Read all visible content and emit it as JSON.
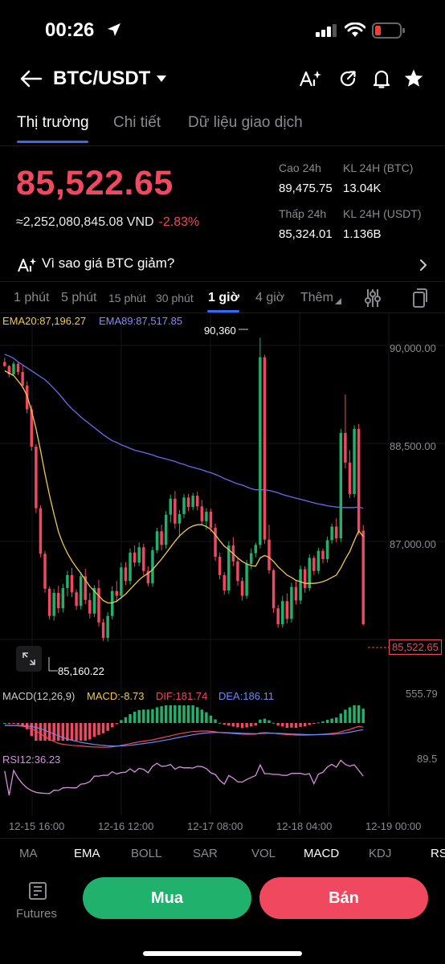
{
  "status": {
    "time": "00:26"
  },
  "header": {
    "pair": "BTC/USDT"
  },
  "tabs": [
    {
      "label": "Thị trường"
    },
    {
      "label": "Chi tiết"
    },
    {
      "label": "Dữ liệu giao dịch"
    }
  ],
  "ticker": {
    "price": "85,522.65",
    "vnd": "≈2,252,080,845.08 VND",
    "change": "-2.83%",
    "high_label": "Cao 24h",
    "high_value": "89,475.75",
    "vol_btc_label": "KL 24H (BTC)",
    "vol_btc_value": "13.04K",
    "low_label": "Thấp 24h",
    "low_value": "85,324.01",
    "vol_usdt_label": "KL 24H  (USDT)",
    "vol_usdt_value": "1.136B"
  },
  "why": {
    "text": "Vì sao giá BTC giảm?"
  },
  "intervals": [
    {
      "label": "1 phút"
    },
    {
      "label": "5 phút"
    },
    {
      "label": "15 phút"
    },
    {
      "label": "30 phút"
    },
    {
      "label": "1 giờ"
    },
    {
      "label": "4 giờ"
    },
    {
      "label": "Thêm"
    }
  ],
  "chart_labels": {
    "ema20": "EMA20:87,196.27",
    "ema89": "EMA89:87,517.85",
    "high_marker": "90,360",
    "low_marker": "85,160.22",
    "last_price": "85,522.65",
    "y_ticks": [
      "90,000.00",
      "88,500.00",
      "87,000.00"
    ],
    "macd_title": "MACD(12,26,9)",
    "macd_val": "MACD:-8.73",
    "dif_val": "DIF:181.74",
    "dea_val": "DEA:186.11",
    "macd_axis": "555.79",
    "rsi_title": "RSI12:36.23",
    "rsi_axis": "89.5",
    "x_ticks": [
      "12-15 16:00",
      "12-16 12:00",
      "12-17 08:00",
      "12-18 04:00",
      "12-19 00:00"
    ]
  },
  "indicator_tabs": [
    {
      "label": "MA"
    },
    {
      "label": "EMA"
    },
    {
      "label": "BOLL"
    },
    {
      "label": "SAR"
    },
    {
      "label": "VOL"
    },
    {
      "label": "MACD"
    },
    {
      "label": "KDJ"
    },
    {
      "label": "RS"
    }
  ],
  "bottom": {
    "futures": "Futures",
    "buy": "Mua",
    "sell": "Bán"
  },
  "colors": {
    "up": "#20b26c",
    "down": "#f0485e",
    "accent": "#2f6df6",
    "ema20": "#f2c94c",
    "ema89": "#6b6bf0",
    "rsi": "#d88ee0"
  },
  "chart_data": {
    "type": "candlestick",
    "ylim": [
      85100,
      90500
    ],
    "candles": [
      [
        89950,
        90020,
        89870,
        89880
      ],
      [
        89880,
        89900,
        89690,
        89740
      ],
      [
        89740,
        89960,
        89730,
        89920
      ],
      [
        89920,
        89950,
        89730,
        89780
      ],
      [
        89780,
        89900,
        89500,
        89550
      ],
      [
        89550,
        89620,
        89080,
        89150
      ],
      [
        89150,
        89220,
        88450,
        88520
      ],
      [
        88520,
        88560,
        87400,
        87480
      ],
      [
        87480,
        87530,
        86650,
        86710
      ],
      [
        86710,
        86760,
        86050,
        86120
      ],
      [
        86120,
        86160,
        85600,
        85660
      ],
      [
        85660,
        86120,
        85580,
        86050
      ],
      [
        86050,
        86170,
        85710,
        85790
      ],
      [
        85790,
        86200,
        85720,
        86130
      ],
      [
        86130,
        86420,
        85990,
        86350
      ],
      [
        86350,
        86470,
        85980,
        86060
      ],
      [
        86060,
        86110,
        85760,
        85830
      ],
      [
        85830,
        86400,
        85770,
        86330
      ],
      [
        86330,
        86460,
        85860,
        85930
      ],
      [
        85930,
        86050,
        85620,
        85700
      ],
      [
        85700,
        86180,
        85640,
        86130
      ],
      [
        86130,
        86270,
        85480,
        85550
      ],
      [
        85550,
        85610,
        85240,
        85290
      ],
      [
        85290,
        85720,
        85230,
        85660
      ],
      [
        85660,
        86160,
        85600,
        86080
      ],
      [
        86080,
        86250,
        85890,
        86000
      ],
      [
        86000,
        86560,
        85940,
        86480
      ],
      [
        86480,
        86570,
        86180,
        86250
      ],
      [
        86250,
        86800,
        86190,
        86730
      ],
      [
        86730,
        86850,
        86490,
        86560
      ],
      [
        86560,
        86900,
        86500,
        86820
      ],
      [
        86820,
        86880,
        86350,
        86420
      ],
      [
        86420,
        86500,
        86160,
        86210
      ],
      [
        86210,
        86830,
        86150,
        86770
      ],
      [
        86770,
        87150,
        86720,
        87090
      ],
      [
        87090,
        87200,
        86770,
        86860
      ],
      [
        86860,
        87430,
        86800,
        87370
      ],
      [
        87370,
        87710,
        87240,
        87640
      ],
      [
        87640,
        87770,
        87130,
        87220
      ],
      [
        87220,
        87450,
        86990,
        87380
      ],
      [
        87380,
        87720,
        87310,
        87660
      ],
      [
        87660,
        87720,
        87430,
        87500
      ],
      [
        87500,
        87740,
        87450,
        87690
      ],
      [
        87690,
        87760,
        87440,
        87510
      ],
      [
        87510,
        87620,
        87190,
        87260
      ],
      [
        87260,
        87480,
        87120,
        87420
      ],
      [
        87420,
        87470,
        87080,
        87150
      ],
      [
        87150,
        87220,
        86590,
        86660
      ],
      [
        86660,
        86730,
        86280,
        86350
      ],
      [
        86350,
        86400,
        86020,
        86090
      ],
      [
        86090,
        86920,
        86030,
        86850
      ],
      [
        86850,
        86990,
        86500,
        86580
      ],
      [
        86580,
        86650,
        86170,
        86250
      ],
      [
        86250,
        86310,
        85920,
        86000
      ],
      [
        86000,
        86610,
        85950,
        86540
      ],
      [
        86540,
        86800,
        86450,
        86720
      ],
      [
        86720,
        86900,
        86650,
        86860
      ],
      [
        86860,
        90360,
        86800,
        90030
      ],
      [
        90030,
        90070,
        86880,
        86950
      ],
      [
        86950,
        87200,
        86370,
        86430
      ],
      [
        86430,
        86460,
        85710,
        85790
      ],
      [
        85790,
        85850,
        85460,
        85520
      ],
      [
        85520,
        86000,
        85460,
        85910
      ],
      [
        85910,
        86040,
        85530,
        85610
      ],
      [
        85610,
        86220,
        85550,
        86150
      ],
      [
        86150,
        86250,
        85850,
        85920
      ],
      [
        85920,
        86510,
        85860,
        86450
      ],
      [
        86450,
        86500,
        86050,
        86130
      ],
      [
        86130,
        86700,
        86080,
        86640
      ],
      [
        86640,
        86680,
        86350,
        86420
      ],
      [
        86420,
        86810,
        86370,
        86760
      ],
      [
        86760,
        86800,
        86550,
        86620
      ],
      [
        86620,
        87000,
        86560,
        86940
      ],
      [
        86940,
        87220,
        86880,
        87170
      ],
      [
        87170,
        87310,
        86900,
        86970
      ],
      [
        86970,
        88820,
        86910,
        88750
      ],
      [
        88750,
        89400,
        88150,
        88250
      ],
      [
        88250,
        88460,
        87650,
        87720
      ],
      [
        87720,
        88880,
        87660,
        88820
      ],
      [
        88820,
        88900,
        87030,
        87100
      ],
      [
        87100,
        87200,
        85500,
        85520
      ]
    ],
    "ema20": [
      89800,
      89760,
      89720,
      89630,
      89530,
      89380,
      89120,
      88820,
      88460,
      88060,
      87700,
      87380,
      87080,
      86880,
      86720,
      86590,
      86480,
      86380,
      86270,
      86160,
      86080,
      86000,
      85920,
      85880,
      85880,
      85910,
      85970,
      86030,
      86110,
      86190,
      86270,
      86330,
      86380,
      86440,
      86530,
      86620,
      86720,
      86820,
      86920,
      87010,
      87080,
      87140,
      87180,
      87200,
      87200,
      87170,
      87120,
      87030,
      86930,
      86840,
      86780,
      86710,
      86640,
      86580,
      86540,
      86510,
      86500,
      86640,
      86680,
      86650,
      86580,
      86490,
      86420,
      86350,
      86310,
      86260,
      86240,
      86210,
      86210,
      86210,
      86220,
      86240,
      86270,
      86310,
      86350,
      86470,
      86620,
      86750,
      86930,
      87100,
      87000
    ],
    "ema89": [
      90080,
      90050,
      90010,
      89950,
      89900,
      89850,
      89800,
      89750,
      89700,
      89650,
      89580,
      89500,
      89420,
      89330,
      89240,
      89160,
      89090,
      89020,
      88960,
      88900,
      88840,
      88780,
      88720,
      88670,
      88620,
      88590,
      88550,
      88520,
      88490,
      88460,
      88440,
      88420,
      88400,
      88380,
      88350,
      88330,
      88310,
      88290,
      88270,
      88240,
      88220,
      88190,
      88170,
      88150,
      88130,
      88100,
      88080,
      88050,
      88020,
      87980,
      87950,
      87920,
      87890,
      87870,
      87840,
      87810,
      87790,
      87790,
      87790,
      87780,
      87760,
      87740,
      87710,
      87690,
      87670,
      87650,
      87630,
      87610,
      87590,
      87570,
      87550,
      87540,
      87520,
      87510,
      87500,
      87490,
      87490,
      87490,
      87490,
      87500,
      87480
    ]
  }
}
